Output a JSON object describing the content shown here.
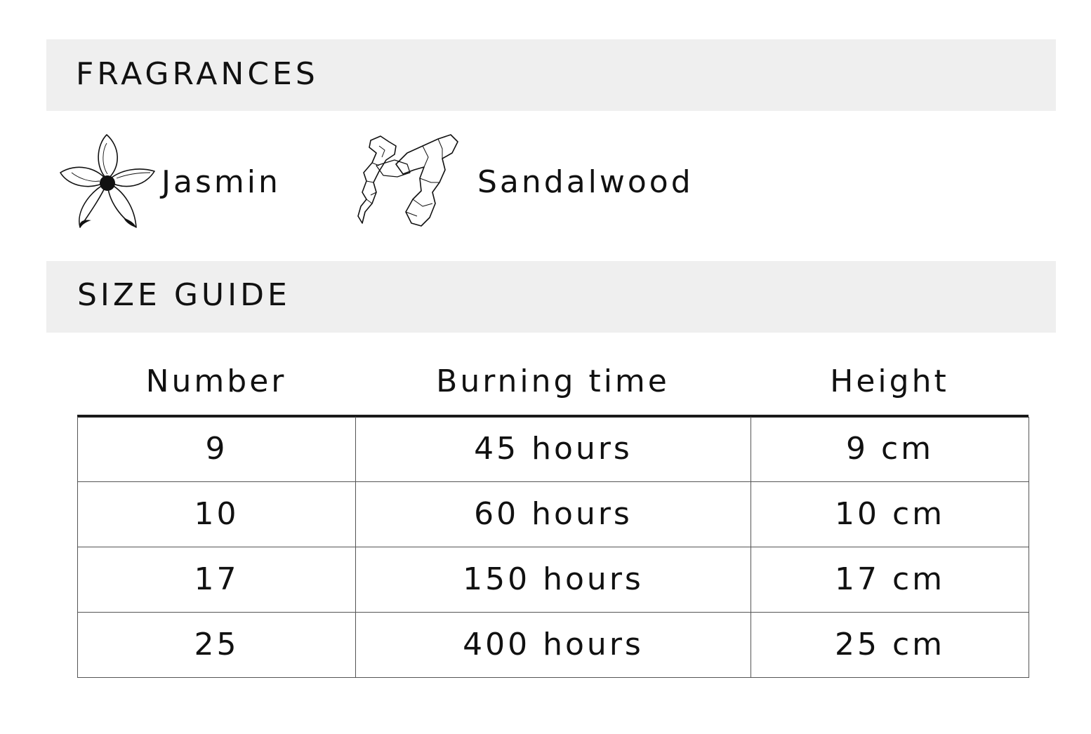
{
  "fragrances": {
    "title": "FRAGRANCES",
    "items": [
      {
        "label": "Jasmin",
        "icon": "jasmine-flower-icon"
      },
      {
        "label": "Sandalwood",
        "icon": "sandalwood-sticks-icon"
      }
    ]
  },
  "size_guide": {
    "title": "SIZE GUIDE",
    "columns": [
      "Number",
      "Burning time",
      "Height"
    ],
    "rows": [
      [
        "9",
        "45 hours",
        "9 cm"
      ],
      [
        "10",
        "60 hours",
        "10 cm"
      ],
      [
        "17",
        "150 hours",
        "17 cm"
      ],
      [
        "25",
        "400 hours",
        "25 cm"
      ]
    ]
  }
}
